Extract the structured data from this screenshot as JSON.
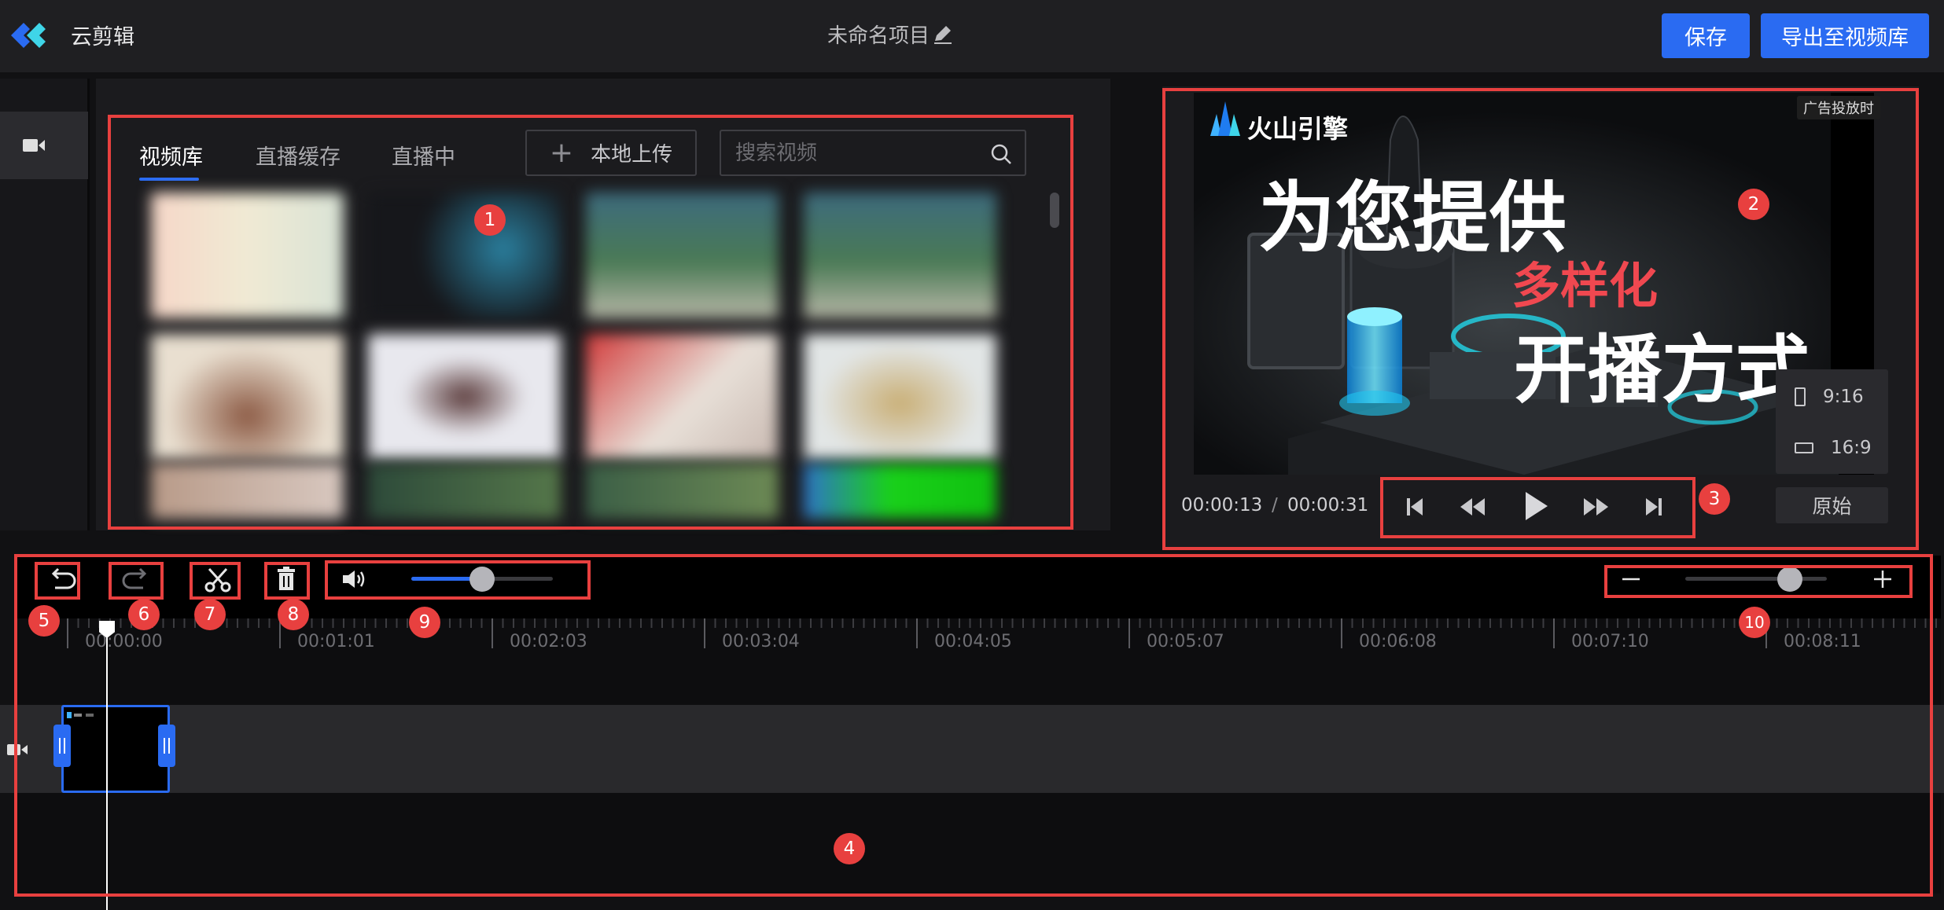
{
  "header": {
    "app_name": "云剪辑",
    "project_title": "未命名项目",
    "save_label": "保存",
    "export_label": "导出至视频库"
  },
  "library": {
    "tabs": [
      "视频库",
      "直播缓存",
      "直播中"
    ],
    "active_tab": "视频库",
    "upload_label": "本地上传",
    "search_placeholder": "搜索视频",
    "thumbnails_blurred": true
  },
  "preview": {
    "brand": "火山引擎",
    "ad_badge": "广告投放时",
    "hero_line_1": "为您提供",
    "hero_line_2": "多样化",
    "hero_line_3": "开播方式",
    "time_current": "00:00:13",
    "time_separator": "/",
    "time_total": "00:00:31",
    "ratio_9_16": "9:16",
    "ratio_16_9": "16:9",
    "original_label": "原始"
  },
  "timeline": {
    "ticks": [
      "00:00:00",
      "00:01:01",
      "00:02:03",
      "00:03:04",
      "00:04:05",
      "00:05:07",
      "00:06:08",
      "00:07:10",
      "00:08:11"
    ],
    "volume_level": 0.5,
    "zoom_level": 0.7
  },
  "annotations": [
    "1",
    "2",
    "3",
    "4",
    "5",
    "6",
    "7",
    "8",
    "9",
    "10"
  ],
  "colors": {
    "accent": "#2a6bf2",
    "annotation": "#e8403f",
    "hero_highlight": "#f04850"
  }
}
